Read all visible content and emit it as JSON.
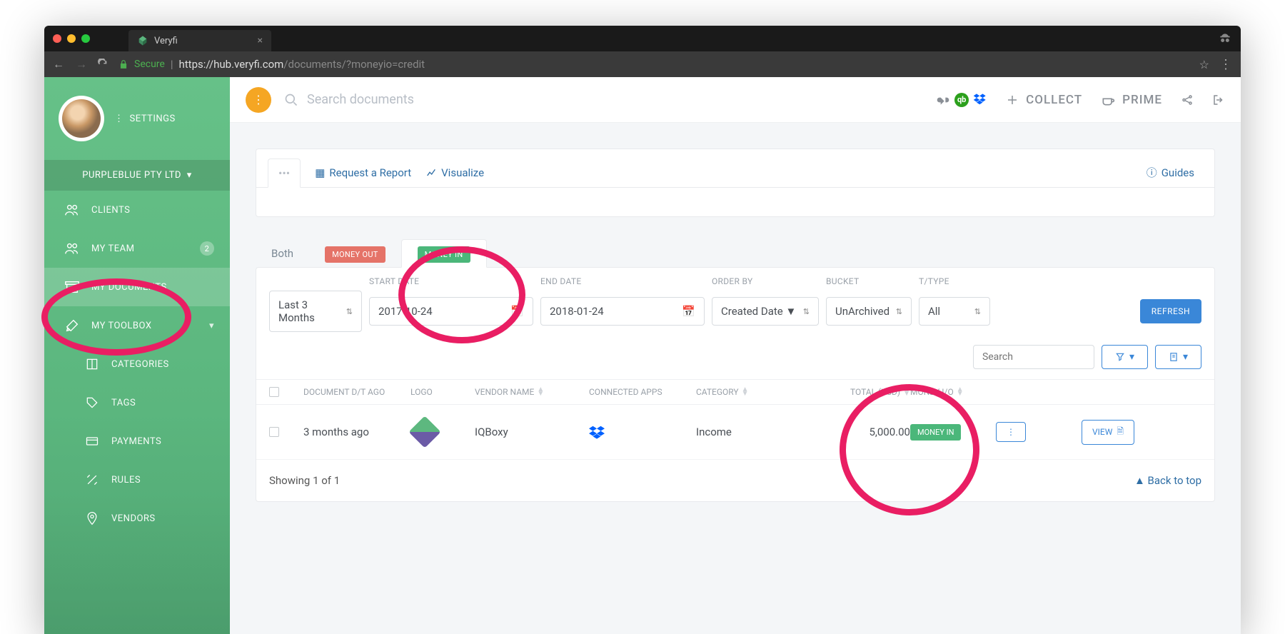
{
  "browser": {
    "tab_title": "Veryfi",
    "secure_label": "Secure",
    "url_host": "https://hub.veryfi.com",
    "url_path": "/documents/?moneyio=credit"
  },
  "sidebar": {
    "settings_label": "SETTINGS",
    "org_name": "PURPLEBLUE PTY LTD",
    "items": [
      {
        "label": "CLIENTS"
      },
      {
        "label": "MY TEAM",
        "badge": "2"
      },
      {
        "label": "MY DOCUMENTS",
        "active": true
      },
      {
        "label": "MY TOOLBOX"
      }
    ],
    "sub_items": [
      {
        "label": "CATEGORIES"
      },
      {
        "label": "TAGS"
      },
      {
        "label": "PAYMENTS"
      },
      {
        "label": "RULES"
      },
      {
        "label": "VENDORS"
      }
    ]
  },
  "header": {
    "search_placeholder": "Search documents",
    "collect_label": "COLLECT",
    "prime_label": "PRIME"
  },
  "actions": {
    "request_report": "Request a Report",
    "visualize": "Visualize",
    "guides": "Guides"
  },
  "money_tabs": {
    "both": "Both",
    "out": "MONEY OUT",
    "in": "MONEY IN"
  },
  "filters": {
    "headers": {
      "start": "START DATE",
      "end": "END DATE",
      "order": "ORDER BY",
      "bucket": "BUCKET",
      "ttype": "T/TYPE"
    },
    "range": "Last 3 Months",
    "start_date": "2017-10-24",
    "end_date": "2018-01-24",
    "order_by": "Created Date ▼",
    "bucket": "UnArchived",
    "ttype": "All",
    "refresh": "REFRESH",
    "search_placeholder": "Search"
  },
  "table": {
    "columns": {
      "doc_dt": "DOCUMENT D/T AGO",
      "logo": "LOGO",
      "vendor": "VENDOR NAME",
      "apps": "CONNECTED APPS",
      "category": "CATEGORY",
      "total": "TOTAL (USD)",
      "moneyio": "MONEY I/O"
    },
    "rows": [
      {
        "dt_ago": "3 months ago",
        "vendor": "IQBoxy",
        "category": "Income",
        "total": "5,000.00",
        "money_badge": "MONEY IN",
        "view": "VIEW"
      }
    ],
    "footer_showing": "Showing 1 of 1",
    "back_to_top": "Back to top"
  }
}
